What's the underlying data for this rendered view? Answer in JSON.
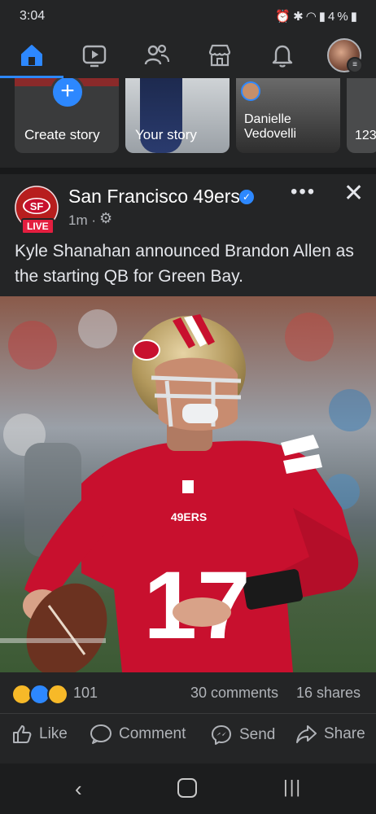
{
  "status_bar": {
    "time": "3:04",
    "battery": "4%"
  },
  "stories": [
    {
      "label": "Create story"
    },
    {
      "label": "Your story"
    },
    {
      "label": "Danielle Vedovelli"
    },
    {
      "label": "123"
    }
  ],
  "post": {
    "page_name": "San Francisco 49ers",
    "live_label": "LIVE",
    "time": "1m ·",
    "text": "Kyle Shanahan announced Brandon Allen as the starting QB for Green Bay.",
    "reaction_count": "101",
    "comments": "30 comments",
    "shares": "16 shares",
    "jersey_text": "49ERS",
    "jersey_number": "17",
    "logo_text": "SF"
  },
  "actions": {
    "like": "Like",
    "comment": "Comment",
    "send": "Send",
    "share": "Share"
  },
  "colors": {
    "accent": "#2d88ff",
    "background": "#242526",
    "team_red": "#c8102e",
    "gold": "#b3995d"
  }
}
